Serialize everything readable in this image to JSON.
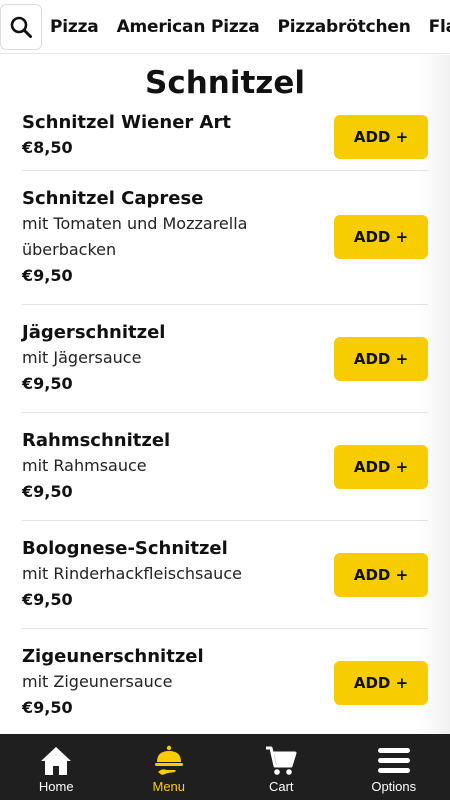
{
  "categories": [
    "Pizza",
    "American Pizza",
    "Pizzabrötchen",
    "Flam"
  ],
  "section": {
    "title": "Schnitzel"
  },
  "items": [
    {
      "name": "Schnitzel Wiener Art",
      "desc": "",
      "price": "€8,50",
      "button": "ADD +"
    },
    {
      "name": "Schnitzel Caprese",
      "desc": "mit Tomaten und Mozzarella überbacken",
      "price": "€9,50",
      "button": "ADD +"
    },
    {
      "name": "Jägerschnitzel",
      "desc": "mit Jägersauce",
      "price": "€9,50",
      "button": "ADD +"
    },
    {
      "name": "Rahmschnitzel",
      "desc": "mit Rahmsauce",
      "price": "€9,50",
      "button": "ADD +"
    },
    {
      "name": "Bolognese-Schnitzel",
      "desc": "mit Rinderhackfleischsauce",
      "price": "€9,50",
      "button": "ADD +"
    },
    {
      "name": "Zigeunerschnitzel",
      "desc": "mit Zigeunersauce",
      "price": "€9,50",
      "button": "ADD +"
    }
  ],
  "nav": [
    {
      "label": "Home",
      "icon": "home-icon"
    },
    {
      "label": "Menu",
      "icon": "menu-cloche-icon",
      "active": true
    },
    {
      "label": "Cart",
      "icon": "cart-icon"
    },
    {
      "label": "Options",
      "icon": "hamburger-icon"
    }
  ],
  "colors": {
    "accent": "#f7cc00",
    "nav_bg": "#1f1f1f",
    "text": "#111111"
  }
}
